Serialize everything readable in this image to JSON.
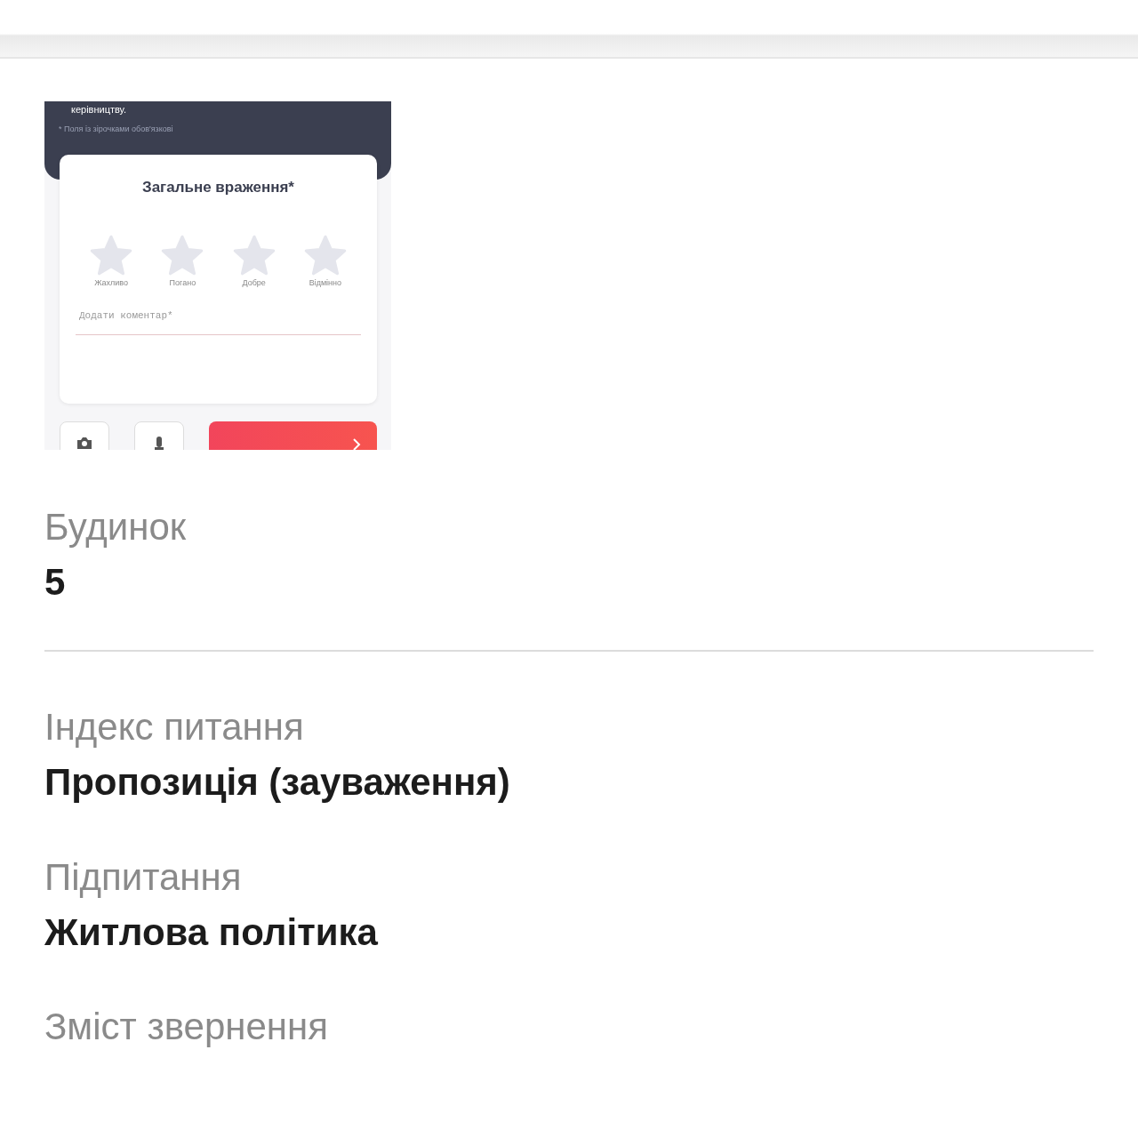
{
  "screenshot": {
    "notice": "керівництву.",
    "required_note": "* Поля із зірочками обов'язкові",
    "rating_title": "Загальне враження*",
    "stars": 0,
    "rating_labels": [
      "Жахливо",
      "Погано",
      "Добре",
      "Відмінно"
    ],
    "comment_placeholder": "Додати коментар*"
  },
  "fields": [
    {
      "label": "Будинок",
      "value": "5",
      "divider": true
    },
    {
      "label": "Індекс питання",
      "value": "Пропозиція (зауваження)",
      "divider": false
    },
    {
      "label": "Підпитання",
      "value": "Житлова політика",
      "divider": false
    },
    {
      "label": "Зміст звернення",
      "divider": false
    }
  ]
}
